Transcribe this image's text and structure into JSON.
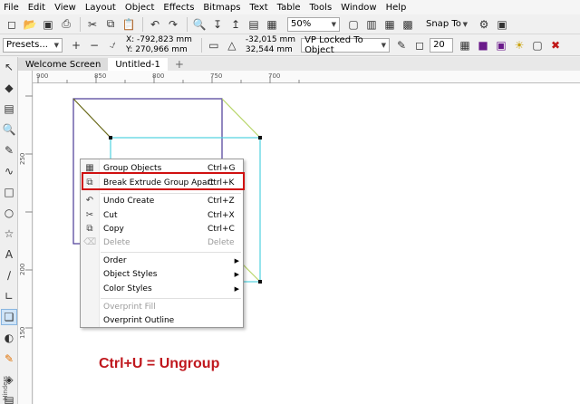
{
  "menubar": [
    "File",
    "Edit",
    "View",
    "Layout",
    "Object",
    "Effects",
    "Bitmaps",
    "Text",
    "Table",
    "Tools",
    "Window",
    "Help"
  ],
  "toolbar1": {
    "zoom": "50%",
    "snap_label": "Snap To"
  },
  "toolbar2": {
    "presets": "Presets...",
    "x": "X: -792,823 mm",
    "y": "Y: 270,966 mm",
    "vp_x": "-32,015 mm",
    "vp_y": "32,544 mm",
    "vp_mode": "VP Locked To Object",
    "depth": "20"
  },
  "tabs": {
    "welcome": "Welcome Screen",
    "doc": "Untitled-1"
  },
  "hruler_ticks": [
    "900",
    "850",
    "800",
    "750",
    "700"
  ],
  "vruler_ticks": [
    "250",
    "200",
    "150"
  ],
  "toolbox_label": "Hinders",
  "context_menu": {
    "group": {
      "label": "Group Objects",
      "shortcut": "Ctrl+G"
    },
    "break_extrude": {
      "label": "Break Extrude Group Apart",
      "shortcut": "Ctrl+K"
    },
    "undo": {
      "label": "Undo Create",
      "shortcut": "Ctrl+Z"
    },
    "cut": {
      "label": "Cut",
      "shortcut": "Ctrl+X"
    },
    "copy": {
      "label": "Copy",
      "shortcut": "Ctrl+C"
    },
    "delete": {
      "label": "Delete",
      "shortcut": "Delete"
    },
    "order": {
      "label": "Order"
    },
    "object_styles": {
      "label": "Object Styles"
    },
    "color_styles": {
      "label": "Color Styles"
    },
    "overprint_fill": {
      "label": "Overprint Fill"
    },
    "overprint_outline": {
      "label": "Overprint Outline"
    }
  },
  "annotation": "Ctrl+U = Ungroup",
  "colors": {
    "annotation": "#c0181e",
    "highlight": "#d01010",
    "front_face": "#4a3a96",
    "back_face": "#4fd2e0",
    "extrude_edge": "#b8d66a"
  }
}
